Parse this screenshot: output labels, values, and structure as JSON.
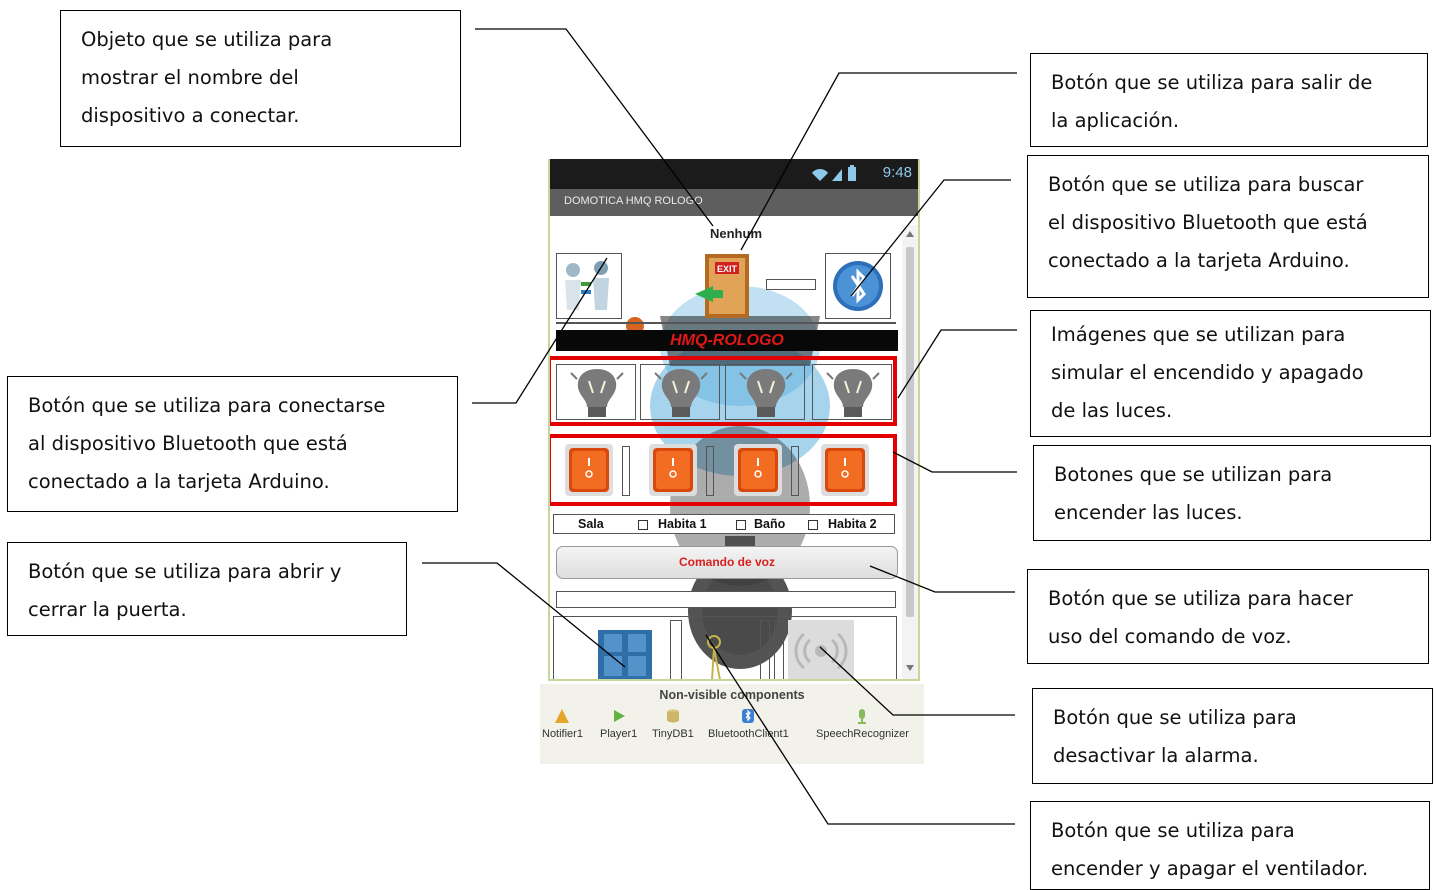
{
  "callouts": {
    "device_name_label": [
      "Objeto que se utiliza para",
      "mostrar el nombre del",
      "dispositivo a conectar."
    ],
    "exit_button": [
      "Botón que se utiliza para salir de",
      "la aplicación."
    ],
    "search_bluetooth": [
      "Botón que se utiliza para buscar",
      "el dispositivo Bluetooth que está",
      "conectado a la tarjeta Arduino."
    ],
    "connect_bluetooth": [
      "Botón que se utiliza para conectarse",
      "al dispositivo Bluetooth que está",
      "conectado a la tarjeta Arduino."
    ],
    "light_images": [
      "Imágenes que se utilizan para",
      "simular el encendido y apagado",
      "de las luces."
    ],
    "light_switches": [
      "Botones  que se utilizan para",
      "encender las luces."
    ],
    "door_button": [
      "Botón que se utiliza para abrir y",
      "cerrar la puerta."
    ],
    "voice_button": [
      "Botón que se utiliza para hacer",
      "uso del comando de voz."
    ],
    "alarm_button": [
      "Botón que se utiliza para",
      "desactivar la alarma."
    ],
    "fan_button": [
      "Botón que se utiliza para",
      "encender y apagar el ventilador."
    ]
  },
  "phone": {
    "time": "9:48",
    "app_title": "DOMOTICA HMQ ROLOGO",
    "device_name": "Nenhum",
    "brand": "HMQ-ROLOGO",
    "exit_label": "EXIT",
    "rooms": [
      "Sala",
      "Habita 1",
      "Baño",
      "Habita 2"
    ],
    "voice_button": "Comando de voz"
  },
  "non_visible": {
    "title": "Non-visible components",
    "items": [
      "Notifier1",
      "Player1",
      "TinyDB1",
      "BluetoothClient1",
      "SpeechRecognizer"
    ]
  },
  "colors": {
    "highlight_frame": "#e30000",
    "brand_text": "#e01818",
    "voice_text": "#d81e1e",
    "status_time": "#8fc9ea"
  }
}
